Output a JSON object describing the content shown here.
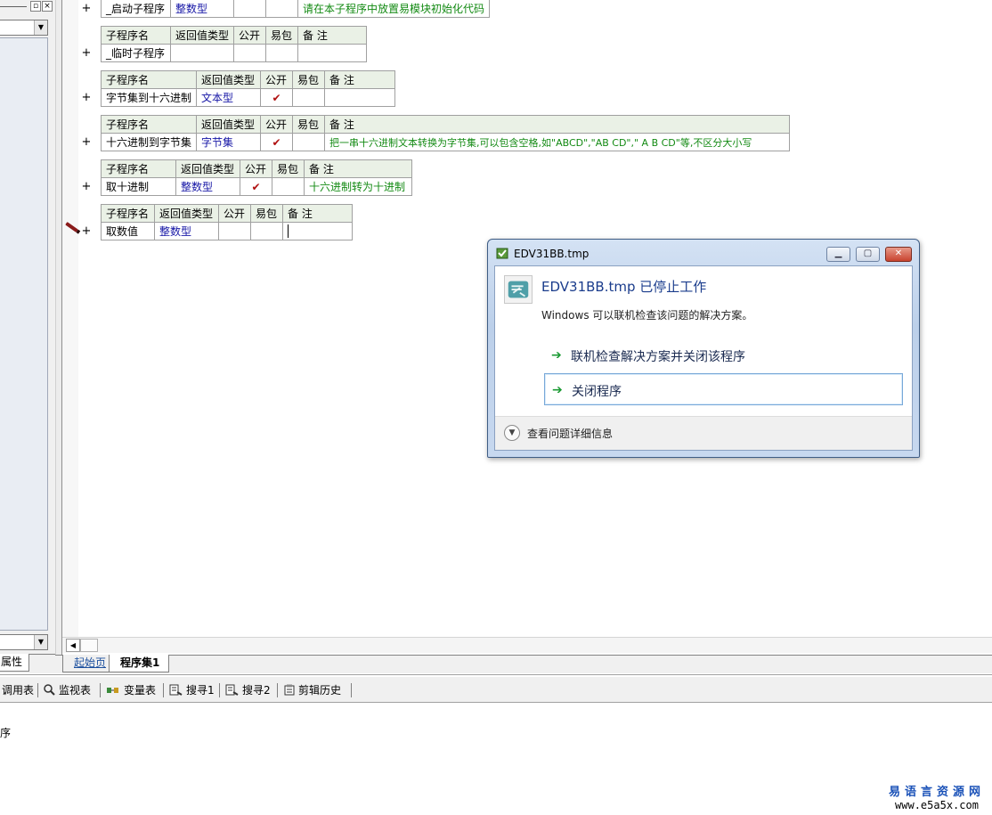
{
  "left_panel": {
    "tab_label": "属性"
  },
  "headers": {
    "sub_name": "子程序名",
    "return_type": "返回值类型",
    "public": "公开",
    "easy_pack": "易包",
    "remark": "备 注"
  },
  "subroutines": [
    {
      "name": "_启动子程序",
      "type": "整数型",
      "public": "",
      "remark": "请在本子程序中放置易模块初始化代码"
    },
    {
      "name": "_临时子程序",
      "type": "",
      "public": "",
      "remark": ""
    },
    {
      "name": "字节集到十六进制",
      "type": "文本型",
      "public": "✔",
      "remark": ""
    },
    {
      "name": "十六进制到字节集",
      "type": "字节集",
      "public": "✔",
      "remark": "把一串十六进制文本转换为字节集,可以包含空格,如\"ABCD\",\"AB CD\",\" A B CD\"等,不区分大小写"
    },
    {
      "name": "取十进制",
      "type": "整数型",
      "public": "✔",
      "remark": "十六进制转为十进制"
    },
    {
      "name": "取数值",
      "type": "整数型",
      "public": "",
      "remark": ""
    }
  ],
  "plus_symbol": "+",
  "tabs": {
    "start_page": "起始页",
    "program_set": "程序集1"
  },
  "toolbar": {
    "call_table": "调用表",
    "watch_table": "监视表",
    "var_table": "变量表",
    "search1": "搜寻1",
    "search2": "搜寻2",
    "clip_history": "剪辑历史"
  },
  "output": {
    "text": "序"
  },
  "watermark": {
    "name": "易语言资源网",
    "url": "www.e5a5x.com"
  },
  "dialog": {
    "title": "EDV31BB.tmp",
    "heading": "EDV31BB.tmp 已停止工作",
    "subtext": "Windows 可以联机检查该问题的解决方案。",
    "option_check": "联机检查解决方案并关闭该程序",
    "option_close": "关闭程序",
    "details": "查看问题详细信息"
  }
}
